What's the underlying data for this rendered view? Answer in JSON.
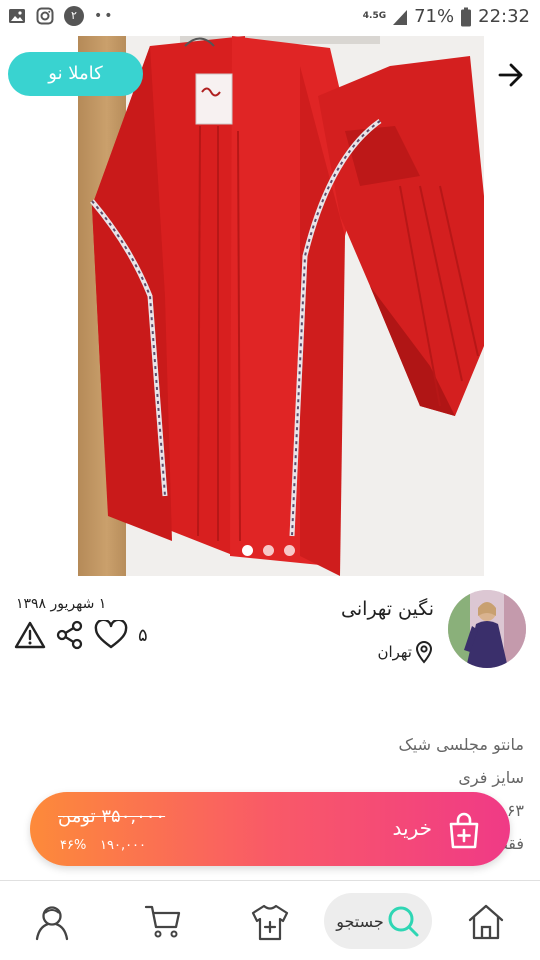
{
  "status_bar": {
    "notification_badge": "۲",
    "dots": "••",
    "network": "4.5G",
    "battery": "71%",
    "time": "22:32"
  },
  "product": {
    "badge": "کاملا نو",
    "image_count": 3,
    "active_image_index": 0
  },
  "seller": {
    "name": "نگین تهرانی",
    "location": "تهران"
  },
  "post": {
    "date": "۱ شهریور ۱۳۹۸",
    "likes": "۵"
  },
  "description": {
    "lines": [
      "مانتو مجلسی شیک",
      "سایز فری",
      "۶۳",
      "فقط"
    ]
  },
  "buy": {
    "label": "خرید",
    "original_price": "۳۵۰,۰۰۰ تومن",
    "discount": "۴۶%",
    "price": "۱۹۰,۰۰۰"
  },
  "nav": {
    "search_label": "جستجو"
  },
  "icons": {
    "status": [
      "gallery-icon",
      "instagram-icon",
      "signal-icon",
      "battery-icon"
    ],
    "actions": [
      "heart-icon",
      "share-icon",
      "report-icon"
    ],
    "nav": [
      "home-icon",
      "search-icon",
      "add-item-icon",
      "cart-icon",
      "profile-icon"
    ]
  },
  "colors": {
    "badge": "#39d3d0",
    "buy_gradient_start": "#fd8a3a",
    "buy_gradient_end": "#f03a86",
    "search_accent": "#2fd6b4",
    "garment": "#e02525"
  }
}
